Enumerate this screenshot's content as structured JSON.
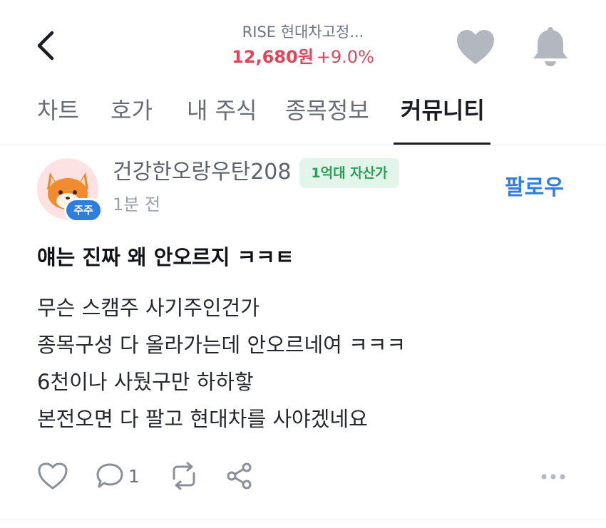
{
  "header": {
    "stock_name": "RISE 현대차고정...",
    "price": "12,680원",
    "change_pct": "+9.0%",
    "price_color": "#e0465a"
  },
  "tabs": [
    {
      "label": "차트",
      "active": false
    },
    {
      "label": "호가",
      "active": false
    },
    {
      "label": "내 주식",
      "active": false
    },
    {
      "label": "종목정보",
      "active": false
    },
    {
      "label": "커뮤니티",
      "active": true
    }
  ],
  "post": {
    "author": {
      "username": "건강한오랑우탄208",
      "rank_badge": "1억대 자산가",
      "avatar_badge": "주주",
      "avatar_icon": "fox-icon"
    },
    "time_ago": "1분 전",
    "follow_label": "팔로우",
    "title": "얘는 진짜 왜 안오르지 ㅋㅋㅌ",
    "body_lines": [
      "무슨 스캠주 사기주인건가",
      "종목구성 다 올라가는데 안오르네여 ㅋㅋㅋ",
      "6천이나 사뒀구만 하하핳",
      "본전오면 다 팔고 현대차를 사야겠네요"
    ],
    "comment_count": "1"
  },
  "icons": {
    "back": "chevron-left-icon",
    "favorite": "heart-icon",
    "alerts": "bell-icon",
    "like": "heart-outline-icon",
    "comment": "comment-icon",
    "repost": "repost-icon",
    "share": "share-icon",
    "more": "more-icon"
  },
  "colors": {
    "accent_blue": "#2f7de1",
    "badge_green_text": "#2a9d57",
    "badge_green_bg": "#e3f5ea"
  }
}
